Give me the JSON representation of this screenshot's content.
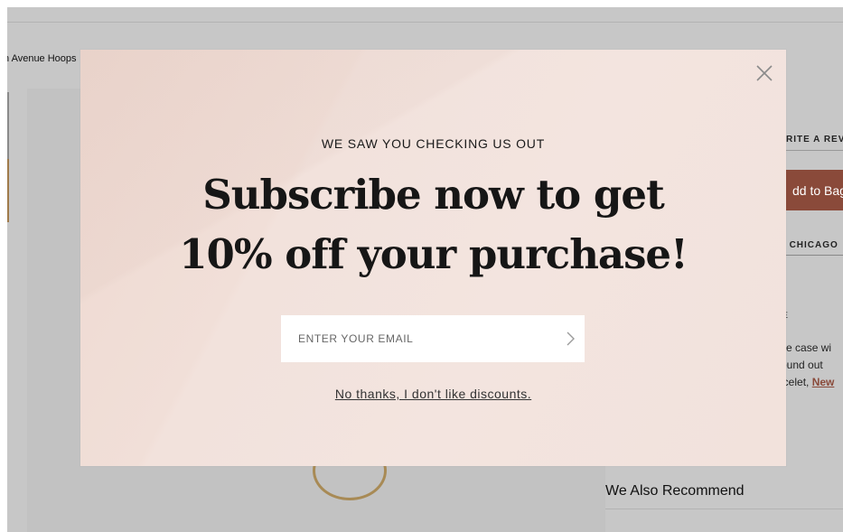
{
  "background_page": {
    "breadcrumb": "n Avenue Hoops",
    "write_review": "RITE A REVIE",
    "add_to_bag": "dd to Bag",
    "location": "| CHICAGO",
    "desc_mark": "E",
    "desc_line1": "the case wi",
    "desc_line2": "round out",
    "desc_line3_prefix": "acelet, ",
    "desc_line3_link": "New",
    "recommend_heading": "We Also Recommend"
  },
  "modal": {
    "eyebrow": "WE SAW YOU CHECKING US OUT",
    "headline_line1": "Subscribe now to get",
    "headline_line2": "10% off your purchase!",
    "email_placeholder": "ENTER YOUR EMAIL",
    "email_value": "",
    "decline_text": "No thanks, I don't like discounts.",
    "close_icon": "close-icon",
    "submit_icon": "chevron-right-icon"
  },
  "colors": {
    "modal_bg": "#f2e2dc",
    "accent": "#8a4a3a",
    "overlay": "#c7c7c7"
  }
}
